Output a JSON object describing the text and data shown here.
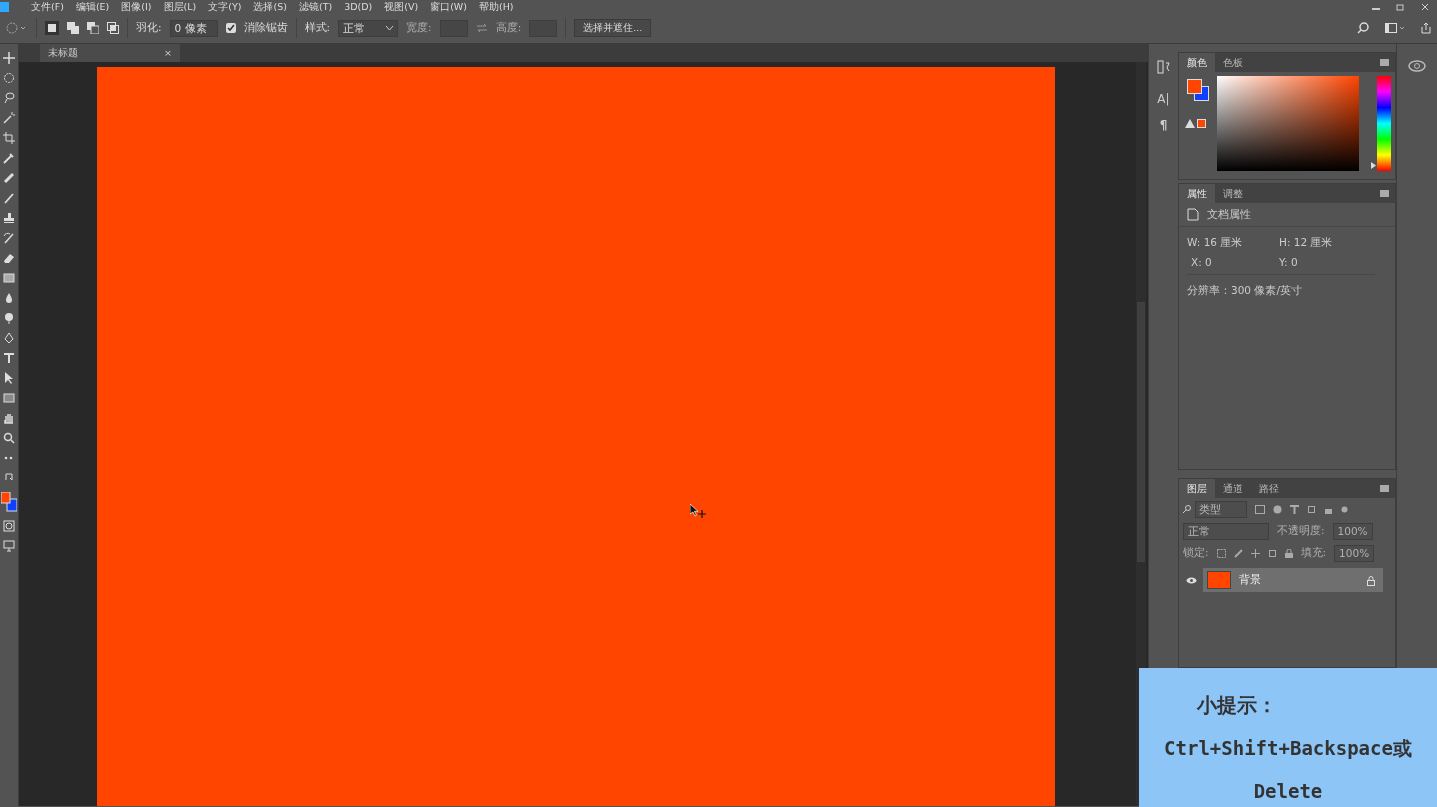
{
  "menu": [
    {
      "label": "文件(F)"
    },
    {
      "label": "编辑(E)"
    },
    {
      "label": "图像(I)"
    },
    {
      "label": "图层(L)"
    },
    {
      "label": "文字(Y)"
    },
    {
      "label": "选择(S)"
    },
    {
      "label": "滤镜(T)"
    },
    {
      "label": "3D(D)"
    },
    {
      "label": "视图(V)"
    },
    {
      "label": "窗口(W)"
    },
    {
      "label": "帮助(H)"
    }
  ],
  "options": {
    "feather_label": "羽化:",
    "feather_value": "0 像素",
    "antialias": {
      "label": "消除锯齿",
      "checked": true
    },
    "style_label": "样式:",
    "style_value": "正常",
    "width_label": "宽度:",
    "height_label": "高度:",
    "select_mask": "选择并遮住..."
  },
  "document_tab": {
    "title": "未标题",
    "close": "×"
  },
  "dock": {
    "character": "A|",
    "paragraph": "¶"
  },
  "color_panel": {
    "tabs": [
      {
        "label": "颜色",
        "selected": true
      },
      {
        "label": "色板",
        "selected": false
      }
    ],
    "hue_slider": {
      "level": 0.02
    }
  },
  "properties_panel": {
    "tabs": [
      {
        "label": "属性",
        "selected": true
      },
      {
        "label": "调整",
        "selected": false
      }
    ],
    "header": "文档属性",
    "w_label": "W:",
    "w_value": "16 厘米",
    "h_label": "H:",
    "h_value": "12 厘米",
    "x_label": "X:",
    "x_value": "0",
    "y_label": "Y:",
    "y_value": "0",
    "resolution": "分辨率：300 像素/英寸"
  },
  "layers_panel": {
    "tabs": [
      {
        "label": "图层",
        "selected": true
      },
      {
        "label": "通道",
        "selected": false
      },
      {
        "label": "路径",
        "selected": false
      }
    ],
    "filter_placeholder": "类型",
    "blend_mode": "正常",
    "opacity_label": "不透明度:",
    "opacity": "100%",
    "lock_label": "锁定:",
    "fill_label": "填充:",
    "fill": "100%",
    "layers": [
      {
        "name": "背景",
        "visible": true,
        "selected": true,
        "locked": true
      }
    ]
  },
  "tip": {
    "title": "小提示：",
    "lines": [
      "Ctrl+Shift+Backspace或",
      "Delete"
    ]
  }
}
